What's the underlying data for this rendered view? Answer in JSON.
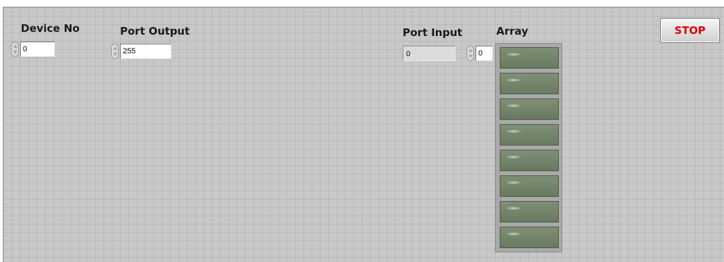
{
  "controls": {
    "device_no": {
      "label": "Device No",
      "value": "0"
    },
    "port_output": {
      "label": "Port Output",
      "value": "255"
    },
    "port_input": {
      "label": "Port Input",
      "value": "0"
    },
    "array": {
      "label": "Array",
      "index": "0",
      "led_count": 8
    }
  },
  "stop_button": {
    "label": "STOP"
  },
  "colors": {
    "panel_bg": "#c8c8c8",
    "led_off": "#738468",
    "stop_text": "#e00000"
  }
}
